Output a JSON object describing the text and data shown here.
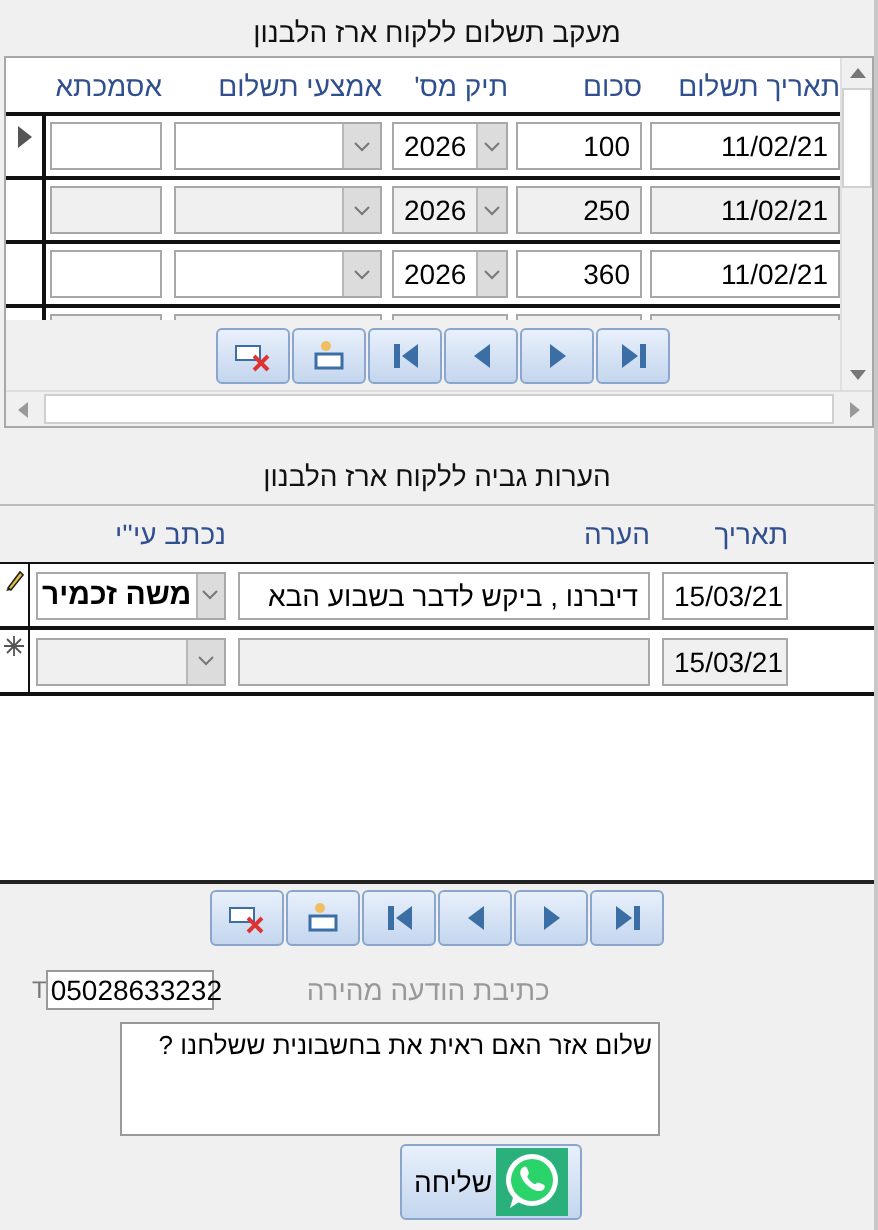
{
  "payments": {
    "title": "מעקב תשלום ללקוח ארז הלבנון",
    "columns": [
      "תאריך תשלום",
      "סכום",
      "תיק מס'",
      "אמצעי תשלום",
      "אסמכתא"
    ],
    "rows": [
      {
        "date": "11/02/21",
        "amount": "100",
        "tax_file": "2026",
        "current": true
      },
      {
        "date": "11/02/21",
        "amount": "250",
        "tax_file": "2026",
        "current": false
      },
      {
        "date": "11/02/21",
        "amount": "360",
        "tax_file": "2026",
        "current": false
      }
    ],
    "nav": [
      {
        "kind": "delete"
      },
      {
        "kind": "new"
      },
      {
        "kind": "first"
      },
      {
        "kind": "prev"
      },
      {
        "kind": "next"
      },
      {
        "kind": "last"
      }
    ]
  },
  "notes": {
    "title": "הערות גביה ללקוח ארז הלבנון",
    "columns": [
      "תאריך",
      "הערה",
      "נכתב עי''י"
    ],
    "rows": [
      {
        "kind": "editing",
        "date": "15/03/21",
        "note": "דיברנו , ביקש לדבר בשבוע הבא",
        "author": "משה זכמיר"
      },
      {
        "kind": "new",
        "date": "15/03/21"
      }
    ],
    "nav": [
      {
        "kind": "delete"
      },
      {
        "kind": "new"
      },
      {
        "kind": "first"
      },
      {
        "kind": "prev"
      },
      {
        "kind": "next"
      },
      {
        "kind": "last"
      }
    ]
  },
  "quick_message": {
    "label": "כתיבת הודעה מהירה",
    "phone_prefix": "T",
    "phone": "05028633232",
    "message": "שלום אזר האם ראית את בחשבונית ששלחנו ?",
    "send_label": "שליחה"
  }
}
